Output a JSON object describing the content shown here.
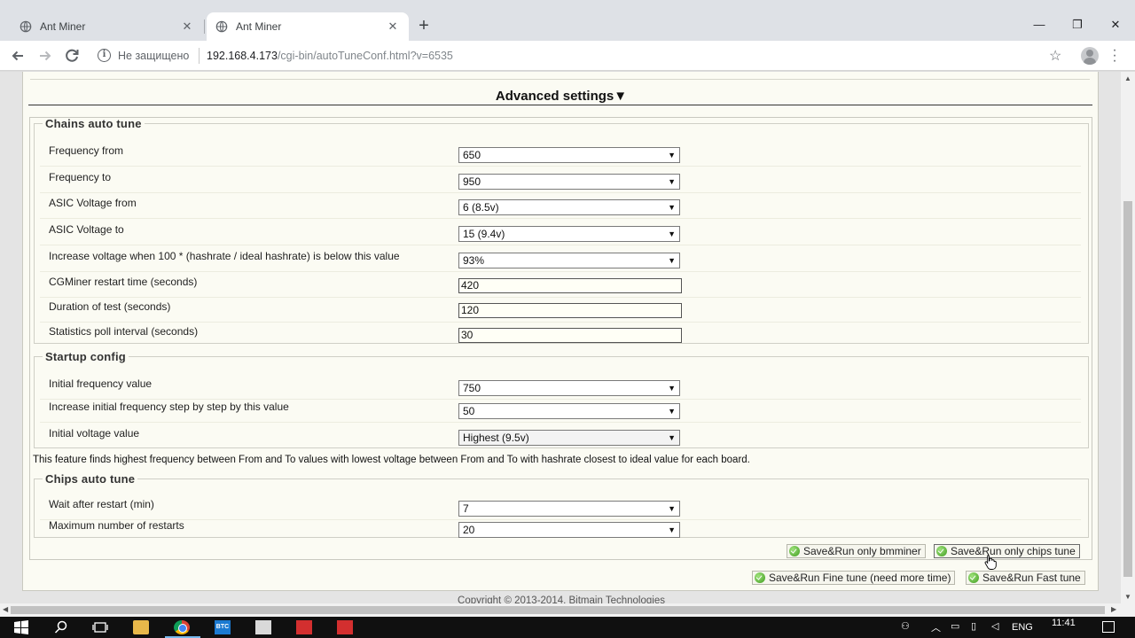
{
  "browser": {
    "tabs": [
      {
        "title": "Ant Miner",
        "active": false
      },
      {
        "title": "Ant Miner",
        "active": true
      }
    ],
    "security_label": "Не защищено",
    "url_host": "192.168.4.173",
    "url_path": "/cgi-bin/autoTuneConf.html?v=6535"
  },
  "page": {
    "section_title": "Advanced settings▼",
    "chains": {
      "legend": "Chains auto tune",
      "rows": [
        {
          "label": "Frequency from",
          "type": "select",
          "value": "650"
        },
        {
          "label": "Frequency to",
          "type": "select",
          "value": "950"
        },
        {
          "label": "ASIC Voltage from",
          "type": "select",
          "value": "6 (8.5v)"
        },
        {
          "label": "ASIC Voltage to",
          "type": "select",
          "value": "15 (9.4v)"
        },
        {
          "label": "Increase voltage when 100 * (hashrate / ideal hashrate) is below this value",
          "type": "select",
          "value": "93%"
        },
        {
          "label": "CGMiner restart time (seconds)",
          "type": "text",
          "value": "420"
        },
        {
          "label": "Duration of test (seconds)",
          "type": "text",
          "value": "120"
        },
        {
          "label": "Statistics poll interval (seconds)",
          "type": "text",
          "value": "30"
        }
      ]
    },
    "startup": {
      "legend": "Startup config",
      "rows": [
        {
          "label": "Initial frequency value",
          "type": "select",
          "value": "750"
        },
        {
          "label": "Increase initial frequency step by step by this value",
          "type": "select",
          "value": "50"
        },
        {
          "label": "Initial voltage value",
          "type": "select",
          "value": "Highest (9.5v)"
        }
      ]
    },
    "note": "This feature finds highest frequency between From and To values with lowest voltage between From and To with hashrate closest to ideal value for each board.",
    "chips": {
      "legend": "Chips auto tune",
      "rows": [
        {
          "label": "Wait after restart (min)",
          "type": "select",
          "value": "7"
        },
        {
          "label": "Maximum number of restarts",
          "type": "select",
          "value": "20"
        }
      ]
    },
    "buttons": {
      "bmminer": "Save&Run only bmminer",
      "chips": "Save&Run only chips tune",
      "fine": "Save&Run Fine tune (need more time)",
      "fast": "Save&Run Fast tune"
    },
    "copyright": "Copyright © 2013-2014, Bitmain Technologies"
  },
  "taskbar": {
    "btc_label": "BTC",
    "lang": "ENG",
    "time": "11:41"
  },
  "colors": {
    "page_bg": "#fbfbf3",
    "ok_icon": "#3f9c1f",
    "taskbar": "#101010"
  }
}
